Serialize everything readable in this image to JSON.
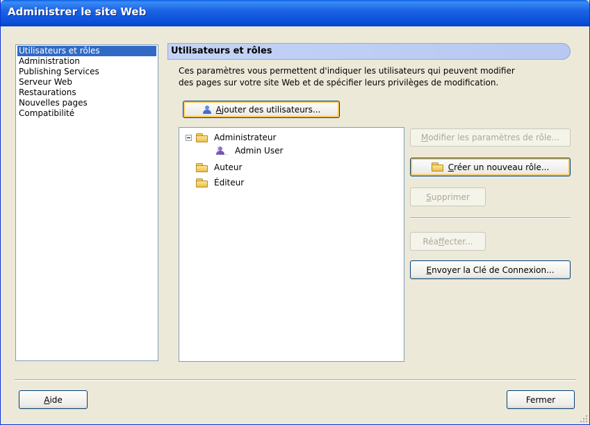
{
  "window": {
    "title": "Administrer le site Web"
  },
  "nav": {
    "items": [
      {
        "label": "Utilisateurs et rôles",
        "selected": true
      },
      {
        "label": "Administration"
      },
      {
        "label": "Publishing Services"
      },
      {
        "label": "Serveur Web"
      },
      {
        "label": "Restaurations"
      },
      {
        "label": "Nouvelles pages"
      },
      {
        "label": "Compatibilité"
      }
    ]
  },
  "section": {
    "title": "Utilisateurs et rôles",
    "description_line1": "Ces paramètres vous permettent d'indiquer les utilisateurs qui peuvent modifier",
    "description_line2": "des pages sur votre site Web et de spécifier leurs privilèges de modification."
  },
  "buttons": {
    "add_users": {
      "mnemonic": "A",
      "rest": "jouter des utilisateurs..."
    },
    "modify_role": {
      "mnemonic": "M",
      "rest": "odifier les paramètres de rôle..."
    },
    "create_role": {
      "mnemonic": "C",
      "rest": "réer un nouveau rôle..."
    },
    "delete": {
      "mnemonic": "S",
      "rest": "upprimer"
    },
    "reassign": {
      "pre": "Réa",
      "mnemonic": "f",
      "rest": "fecter..."
    },
    "send_key": {
      "mnemonic": "E",
      "rest": "nvoyer la Clé de Connexion..."
    },
    "help": {
      "mnemonic": "A",
      "rest": "ide"
    },
    "close": {
      "label": "Fermer"
    }
  },
  "tree": {
    "roles": [
      {
        "label": "Administrateur",
        "users": [
          {
            "label": "Admin User"
          }
        ]
      },
      {
        "label": "Auteur"
      },
      {
        "label": "Éditeur"
      }
    ]
  },
  "icons": {
    "folder": "folder-icon",
    "user": "user-icon"
  },
  "colors": {
    "title_bar": "#0a4fd8",
    "selection": "#316ac5",
    "header_band": "#b7c9f2"
  }
}
